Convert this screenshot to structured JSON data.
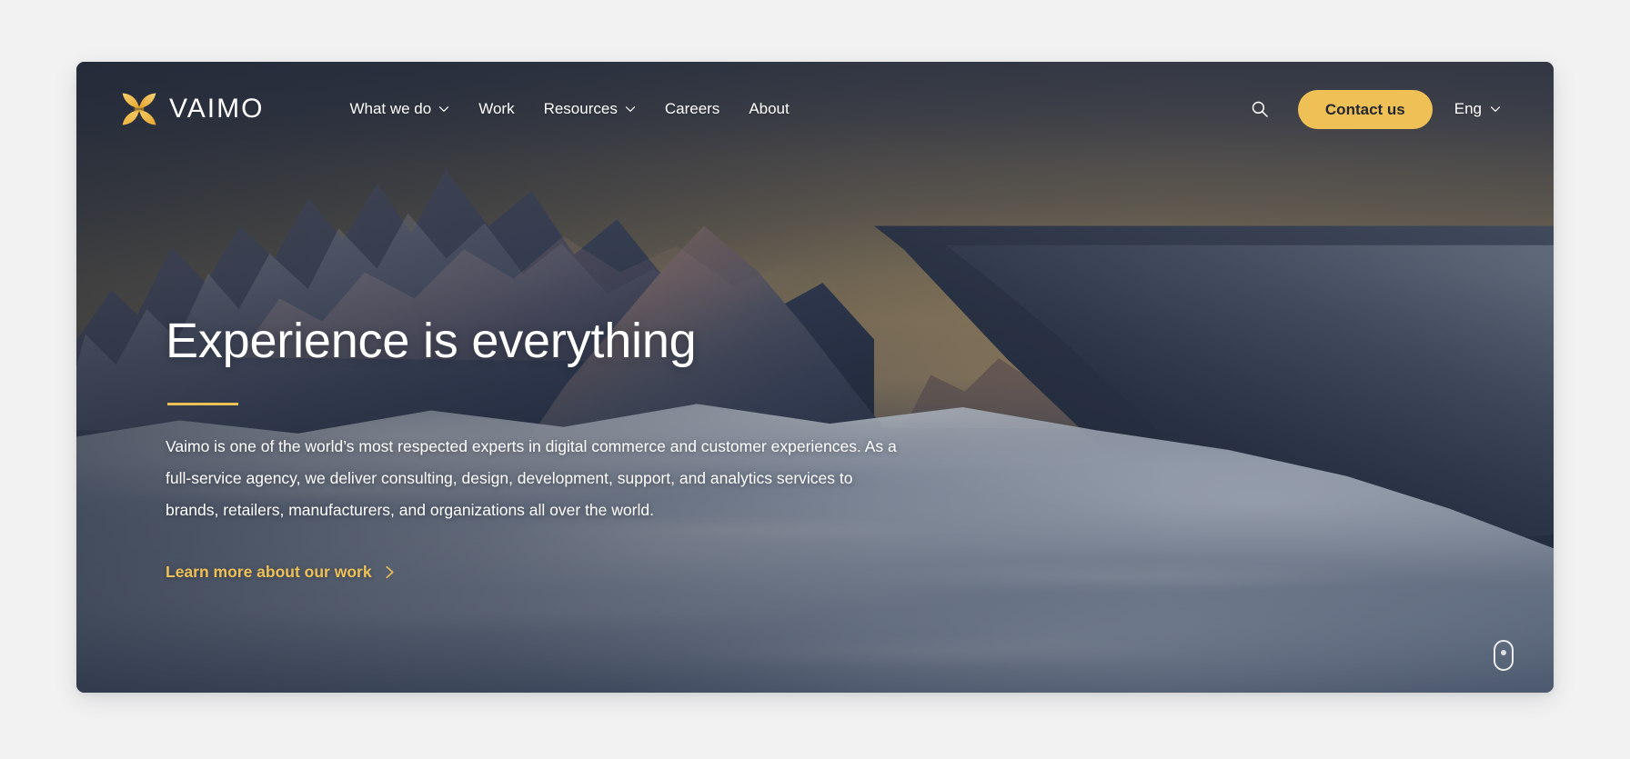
{
  "brand": {
    "name": "VAIMO",
    "logo_icon": "vaimo-x-logo-icon",
    "logo_color": "#efc056"
  },
  "nav": {
    "items": [
      {
        "label": "What we do",
        "has_dropdown": true,
        "icon": "chevron-down-icon"
      },
      {
        "label": "Work",
        "has_dropdown": false,
        "icon": ""
      },
      {
        "label": "Resources",
        "has_dropdown": true,
        "icon": "chevron-down-icon"
      },
      {
        "label": "Careers",
        "has_dropdown": false,
        "icon": ""
      },
      {
        "label": "About",
        "has_dropdown": false,
        "icon": ""
      }
    ]
  },
  "header_right": {
    "search_icon": "search-icon",
    "contact_label": "Contact us",
    "contact_bg": "#efc056",
    "contact_text_color": "#24272e",
    "language": "Eng",
    "language_icon": "chevron-down-icon"
  },
  "hero": {
    "title": "Experience is everything",
    "divider_color": "#efc056",
    "body": "Vaimo is one of the world’s most respected experts in digital commerce and customer experiences. As a full-service agency, we deliver consulting, design, development, support, and analytics services to brands, retailers, manufacturers, and organizations all over the world.",
    "cta_label": "Learn more about our work",
    "cta_icon": "chevron-right-icon",
    "cta_color": "#efc056",
    "background_image": "mountain-range-above-cloud-sea-at-dusk",
    "scroll_indicator_icon": "mouse-scroll-icon"
  },
  "page": {
    "background_color": "#f2f2f2",
    "card_radius_px": 9
  }
}
